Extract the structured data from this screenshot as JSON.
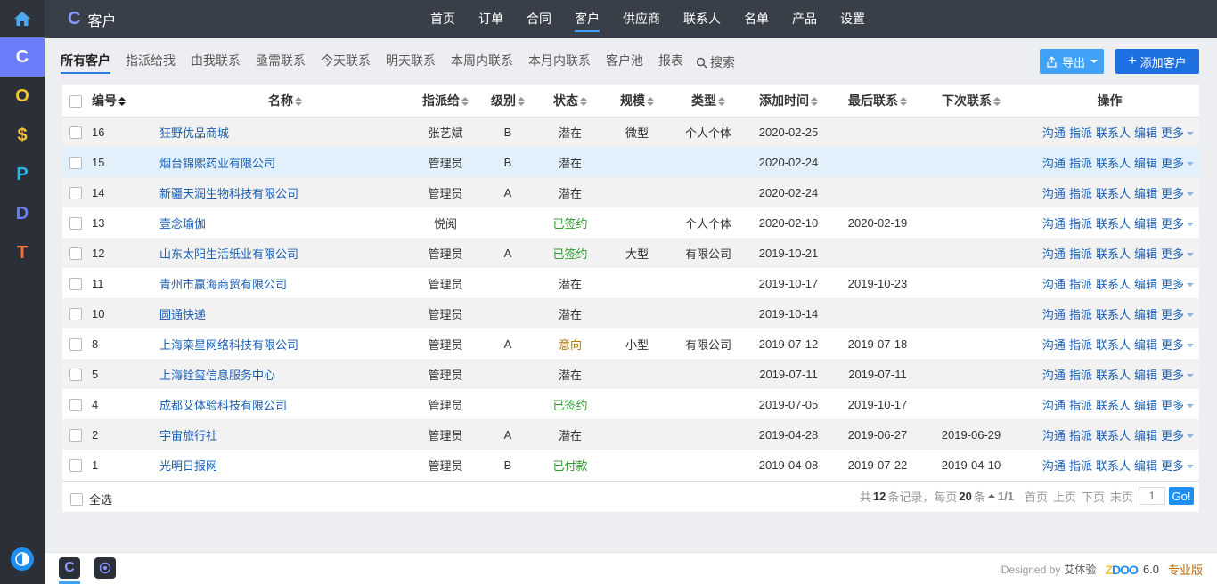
{
  "leftbar": {
    "items": [
      {
        "label": "C",
        "color": "#ffffff"
      },
      {
        "label": "O",
        "color": "#f3c330"
      },
      {
        "label": "$",
        "color": "#f3c330"
      },
      {
        "label": "P",
        "color": "#2ab6e3"
      },
      {
        "label": "D",
        "color": "#6c7dfa"
      },
      {
        "label": "T",
        "color": "#f0743a"
      }
    ]
  },
  "header": {
    "app_title": "客户",
    "nav": [
      "首页",
      "订单",
      "合同",
      "客户",
      "供应商",
      "联系人",
      "名单",
      "产品",
      "设置"
    ]
  },
  "subnav": {
    "items": [
      "所有客户",
      "指派给我",
      "由我联系",
      "亟需联系",
      "今天联系",
      "明天联系",
      "本周内联系",
      "本月内联系",
      "客户池",
      "报表"
    ],
    "search_label": "搜索"
  },
  "toolbar": {
    "export_label": "导出",
    "add_label": "添加客户"
  },
  "table": {
    "headers": {
      "id": "编号",
      "name": "名称",
      "assigned": "指派给",
      "level": "级别",
      "status": "状态",
      "scale": "规模",
      "type": "类型",
      "created": "添加时间",
      "last_contact": "最后联系",
      "next_contact": "下次联系",
      "actions": "操作"
    },
    "action_labels": {
      "contact": "沟通",
      "assign": "指派",
      "contacts": "联系人",
      "edit": "编辑",
      "more": "更多"
    },
    "rows": [
      {
        "id": "16",
        "name": "狂野优品商城",
        "assigned": "张艺斌",
        "level": "B",
        "status": "潜在",
        "scale": "微型",
        "type": "个人个体",
        "created": "2020-02-25",
        "last": "",
        "next": ""
      },
      {
        "id": "15",
        "name": "烟台锦熙药业有限公司",
        "assigned": "管理员",
        "level": "B",
        "status": "潜在",
        "scale": "",
        "type": "",
        "created": "2020-02-24",
        "last": "",
        "next": ""
      },
      {
        "id": "14",
        "name": "新疆天润生物科技有限公司",
        "assigned": "管理员",
        "level": "A",
        "status": "潜在",
        "scale": "",
        "type": "",
        "created": "2020-02-24",
        "last": "",
        "next": ""
      },
      {
        "id": "13",
        "name": "壹念瑜伽",
        "assigned": "悦阅",
        "level": "",
        "status": "已签约",
        "scale": "",
        "type": "个人个体",
        "created": "2020-02-10",
        "last": "2020-02-19",
        "next": ""
      },
      {
        "id": "12",
        "name": "山东太阳生活纸业有限公司",
        "assigned": "管理员",
        "level": "A",
        "status": "已签约",
        "scale": "大型",
        "type": "有限公司",
        "created": "2019-10-21",
        "last": "",
        "next": ""
      },
      {
        "id": "11",
        "name": "青州市赢海商贸有限公司",
        "assigned": "管理员",
        "level": "",
        "status": "潜在",
        "scale": "",
        "type": "",
        "created": "2019-10-17",
        "last": "2019-10-23",
        "next": ""
      },
      {
        "id": "10",
        "name": "圆通快递",
        "assigned": "管理员",
        "level": "",
        "status": "潜在",
        "scale": "",
        "type": "",
        "created": "2019-10-14",
        "last": "",
        "next": ""
      },
      {
        "id": "8",
        "name": "上海栾星网络科技有限公司",
        "assigned": "管理员",
        "level": "A",
        "status": "意向",
        "scale": "小型",
        "type": "有限公司",
        "created": "2019-07-12",
        "last": "2019-07-18",
        "next": ""
      },
      {
        "id": "5",
        "name": "上海铨玺信息服务中心",
        "assigned": "管理员",
        "level": "",
        "status": "潜在",
        "scale": "",
        "type": "",
        "created": "2019-07-11",
        "last": "2019-07-11",
        "next": ""
      },
      {
        "id": "4",
        "name": "成都艾体验科技有限公司",
        "assigned": "管理员",
        "level": "",
        "status": "已签约",
        "scale": "",
        "type": "",
        "created": "2019-07-05",
        "last": "2019-10-17",
        "next": ""
      },
      {
        "id": "2",
        "name": "宇宙旅行社",
        "assigned": "管理员",
        "level": "A",
        "status": "潜在",
        "scale": "",
        "type": "",
        "created": "2019-04-28",
        "last": "2019-06-27",
        "next": "2019-06-29"
      },
      {
        "id": "1",
        "name": "光明日报网",
        "assigned": "管理员",
        "level": "B",
        "status": "已付款",
        "scale": "",
        "type": "",
        "created": "2019-04-08",
        "last": "2019-07-22",
        "next": "2019-04-10"
      }
    ]
  },
  "footer": {
    "select_all": "全选",
    "pager": {
      "prefix": "共",
      "total": "12",
      "records_suffix": "条记录，每页",
      "per_page": "20",
      "per_page_suffix": "条",
      "page_info": "1/1",
      "first": "首页",
      "prev": "上页",
      "next": "下页",
      "last": "末页",
      "page_input": "1",
      "go": "Go!"
    }
  },
  "brand": {
    "designed_by": "Designed by",
    "designer": "艾体验",
    "product": "ZDOO",
    "version": "6.0",
    "edition": "专业版"
  },
  "colors": {
    "accent": "#6c7dfa",
    "link": "#1a5fb4",
    "primary_button": "#1e6fe0",
    "export_button": "#3fa2f7",
    "status_signed": "#2d9c2d",
    "status_intent": "#b5730a"
  }
}
